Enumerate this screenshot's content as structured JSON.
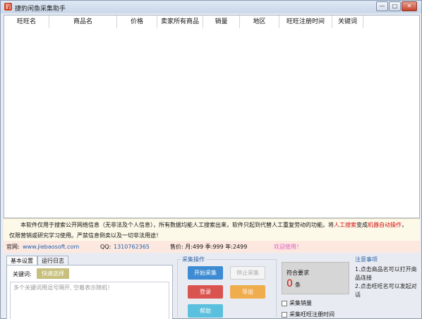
{
  "window": {
    "title": "捷豹闲鱼采集助手",
    "minimize": "—",
    "maximize": "□",
    "close": "✕",
    "icon": "app-logo-icon"
  },
  "grid": {
    "columns": [
      "旺旺名",
      "商品名",
      "价格",
      "卖家所有商品",
      "销量",
      "地区",
      "旺旺注册时间",
      "关键词"
    ]
  },
  "notice": {
    "line1_a": "本软件仅用于搜索公开网络信息（无非法及个人信息），所有数据均能人工搜索出来，软件只起到代替人工重复劳动的功能。将",
    "line1_b": "人工搜索",
    "line1_c": "变成",
    "line1_d": "机器自动操作",
    "line1_e": "，",
    "line2": "仅限营销或研究学习使用。严禁信息倒卖以及一切非法用途！"
  },
  "info": {
    "site_label": "官网:",
    "site": "www.jiebaosoft.com",
    "qq_label": "QQ:",
    "qq": "1310762365",
    "price": "售价: 月:499  季:999  年:2499",
    "welcome": "欢迎使用！"
  },
  "tabs": [
    "基本设置",
    "运行日志"
  ],
  "settings": {
    "kw_label": "关键词:",
    "quick_select": "快速选择",
    "kw_placeholder": "多个关键词用逗号隔开, 空着表示随机！"
  },
  "ops": {
    "title": "采集操作",
    "start": "开始采集",
    "stop": "停止采集",
    "login": "登录",
    "export": "导出",
    "help": "帮助"
  },
  "req": {
    "title": "符合要求",
    "count": "0",
    "unit": "条"
  },
  "checks": [
    "采集销量",
    "采集旺旺注册时间"
  ],
  "notes": {
    "title": "注意事项",
    "body": "1.点击商品名可以打开商品连接\n2.点击旺旺名可以发起对话"
  }
}
